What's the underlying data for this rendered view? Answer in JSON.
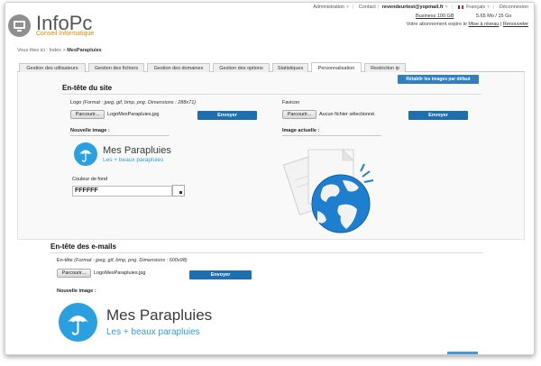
{
  "header": {
    "brand": "InfoPc",
    "tagline": "Conseil Informatique",
    "nav": {
      "admin": "Administration",
      "contact": "Contact",
      "account": "revendeurtest@yopmail.fr",
      "language": "Français",
      "logout": "Déconnexion"
    },
    "plan": "Business 100 GB",
    "storage": "5.65 Mo / 15 Go",
    "expiry_text": "Votre abonnement expire le",
    "expiry_link": "Mise à niveau",
    "renew_link": "Renouveler"
  },
  "breadcrumb": {
    "prefix": "Vous êtes ici :",
    "path": "Index",
    "current": "MesParapluies"
  },
  "tabs": [
    "Gestion des utilisateurs",
    "Gestion des fichiers",
    "Gestion des domaines",
    "Gestion des options",
    "Statistiques",
    "Personnalisation",
    "Restriction ip"
  ],
  "reset_button": "Rétablir les images par défaut",
  "site_header": {
    "title": "En-tête du site",
    "logo_label": "Logo",
    "logo_format": "(Format : jpeg, gif, bmp, png. Dimensions : 288x71)",
    "browse": "Parcourir...",
    "logo_file": "LogoMesParapluies.jpg",
    "send": "Envoyer",
    "new_image": "Nouvelle image :",
    "bg_color_label": "Couleur de fond",
    "bg_color_value": "FFFFFF",
    "favicon_label": "Favicon",
    "favicon_file": "Aucun fichier sélectionné.",
    "current_image": "Image actuelle :"
  },
  "email_header": {
    "title": "En-tête des e-mails",
    "label": "En-tête",
    "format": "(Format : jpeg, gif, bmp, png. Dimensions : 600x98)",
    "browse": "Parcourir...",
    "file": "LogoMesParapluies.jpg",
    "send": "Envoyer",
    "new_image": "Nouvelle image :"
  },
  "preview_logo": {
    "name": "Mes Parapluies",
    "subtitle": "Les +  beaux parapluies"
  },
  "colors": {
    "accent_blue": "#2f7fc1",
    "brand_orange": "#e58a00",
    "logo_blue": "#2aa0e0"
  }
}
